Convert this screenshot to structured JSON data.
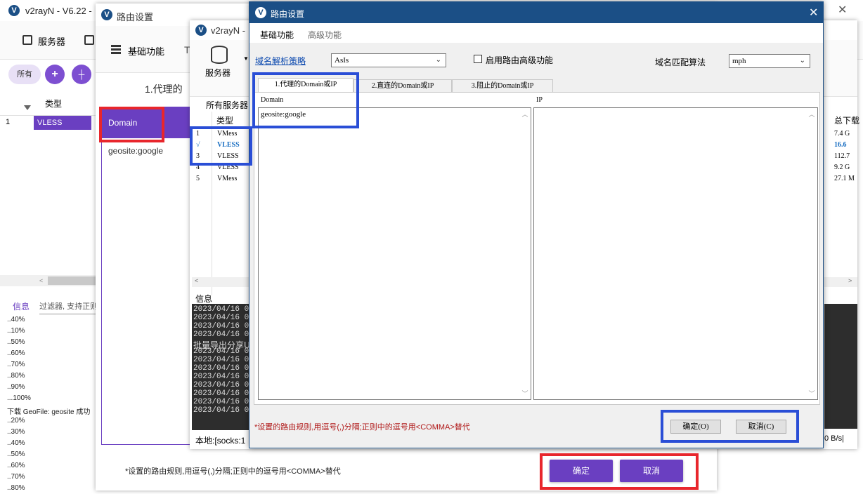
{
  "colors": {
    "accent": "#6a3fc1",
    "title_dark": "#1b4f86",
    "highlight_red": "#e8262c",
    "highlight_blue": "#2a4ed6"
  },
  "main_window": {
    "title": "v2rayN - V6.22 -",
    "toolbar_servers": "服务器",
    "filter_all": "所有",
    "add_icon": "+",
    "grid_col_type": "类型",
    "row1_index": "1",
    "row1_type": "VLESS",
    "tab_info": "信息",
    "filter_placeholder": "过滤器, 支持正则",
    "progress_lines": [
      "..40%",
      "..10%",
      "..50%",
      "..60%",
      "..70%",
      "..80%",
      "..90%",
      "...100%",
      "下载 GeoFile: geosite 成功",
      "..20%",
      "..30%",
      "..40%",
      "..50%",
      "..60%",
      "..70%",
      "..80%"
    ]
  },
  "material_dialog": {
    "title": "路由设置",
    "toolbar_basic": "基础功能",
    "tab_label": "1.代理的",
    "column_domain": "Domain",
    "domain_value": "geosite:google",
    "note": "*设置的路由规则,用逗号(,)分隔;正则中的逗号用<COMMA>替代",
    "ok": "确定",
    "cancel": "取消"
  },
  "second_window": {
    "title": "v2rayN -",
    "toolbar_servers": "服务器",
    "all_servers": "所有服务器",
    "col_type": "类型",
    "servers": [
      {
        "idx": "1",
        "type": "VMess"
      },
      {
        "idx": "√",
        "type": "VLESS"
      },
      {
        "idx": "3",
        "type": "VLESS"
      },
      {
        "idx": "4",
        "type": "VLESS"
      },
      {
        "idx": "5",
        "type": "VMess"
      }
    ],
    "info": "信息",
    "log_lines": [
      "2023/04/16 08",
      "2023/04/16 08",
      "2023/04/16 08",
      "2023/04/16 08",
      "批量导出分享U",
      "2023/04/16 08",
      "2023/04/16 08",
      "2023/04/16 08",
      "2023/04/16 08",
      "2023/04/16 08",
      "2023/04/16 08",
      "2023/04/16 08",
      "2023/04/16 08"
    ],
    "status": "本地:[socks:1",
    "right_col_header": "总下载",
    "right_values": [
      "7.4 G",
      "16.6",
      "112.7",
      "9.2 G",
      "27.1 M"
    ],
    "speed": "0 B/s|"
  },
  "classic_dialog": {
    "title": "路由设置",
    "menu": [
      "基础功能",
      "高级功能"
    ],
    "dns_strategy_label": "域名解析策略",
    "dns_strategy_value": "AsIs",
    "enable_advanced": "启用路由高级功能",
    "domain_match_label": "域名匹配算法",
    "domain_match_value": "mph",
    "tabs": [
      "1.代理的Domain或IP",
      "2.直连的Domain或IP",
      "3.阻止的Domain或IP"
    ],
    "domain_header": "Domain",
    "ip_header": "IP",
    "domain_value": "geosite:google",
    "note": "*设置的路由规则,用逗号(,)分隔;正则中的逗号用<COMMA>替代",
    "ok": "确定(O)",
    "cancel": "取消(C)"
  }
}
